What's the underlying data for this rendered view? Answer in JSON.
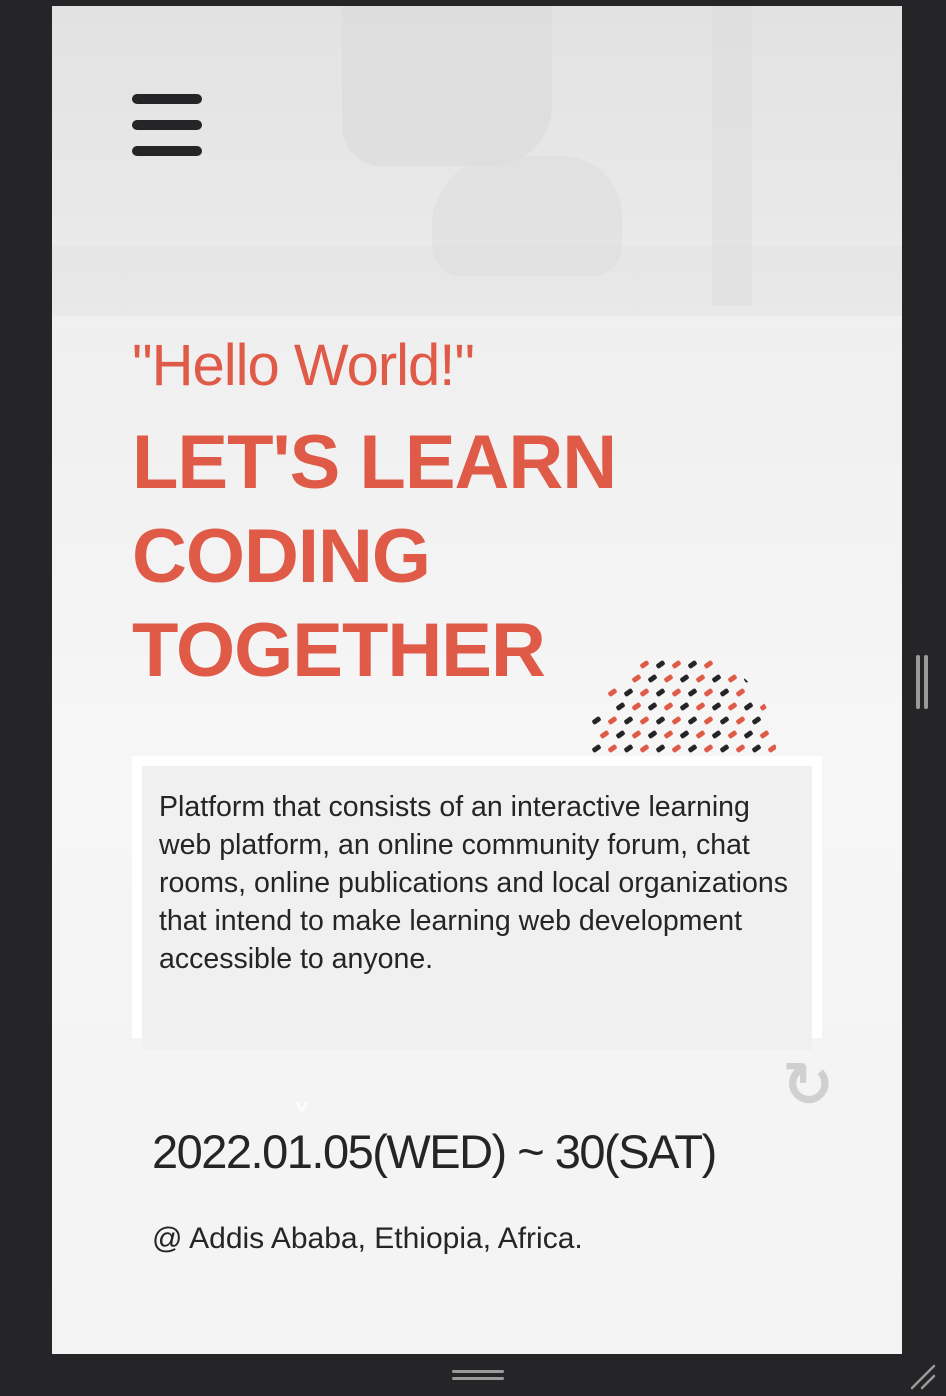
{
  "menu": {
    "icon": "hamburger-menu-icon"
  },
  "hero": {
    "greeting": "\"Hello World!\"",
    "headline": "LET'S LEARN CODING TOGETHER"
  },
  "description": "Platform that consists of an interactive learning web platform, an online community forum, chat rooms, online publications and local organizations that intend to make learning web development accessible to anyone.",
  "event": {
    "date": "2022.01.05(WED) ~ 30(SAT)",
    "location": "@ Addis Ababa, Ethiopia, Africa."
  },
  "colors": {
    "accent": "#e05a48",
    "text": "#252527",
    "background": "#f4f4f4",
    "frame": "#252527"
  },
  "icons": {
    "refresh": "refresh-icon",
    "resize": "resize-grip-icon"
  }
}
